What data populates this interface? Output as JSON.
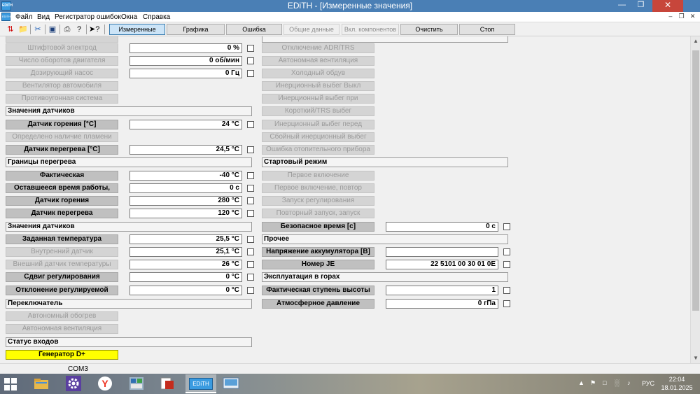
{
  "window": {
    "title": "EDiTH - [Измеренные значения]",
    "app_icon_text": "EDiTH",
    "buttons": [
      "minimize-icon",
      "restore-icon",
      "close-icon"
    ]
  },
  "menu": {
    "items": [
      "Файл",
      "Вид",
      "Регистратор ошибок",
      "Окна",
      "Справка"
    ]
  },
  "toolbar": {
    "icons": [
      "connect-icon",
      "open-folder-icon",
      "cut-icon",
      "save-icon",
      "print-icon",
      "info-icon",
      "help-icon"
    ],
    "tabs": [
      {
        "label": "Измеренные значения",
        "state": "active"
      },
      {
        "label": "Графика",
        "state": "normal"
      },
      {
        "label": "Ошибка",
        "state": "normal"
      },
      {
        "label": "Общие данные",
        "state": "disabled"
      },
      {
        "label": "Вкл. компонентов",
        "state": "disabled"
      },
      {
        "label": "Очистить",
        "state": "normal"
      },
      {
        "label": "Стоп",
        "state": "normal"
      }
    ]
  },
  "left": {
    "top_rows": [
      {
        "label": "Штифтовой электрод",
        "value": "0 %"
      },
      {
        "label": "Число оборотов двигателя",
        "value": "0 об/мин"
      },
      {
        "label": "Дозирующий насос",
        "value": "0 Гц"
      },
      {
        "label": "Вентилятор автомобиля",
        "value": null
      },
      {
        "label": "Противоугонная система",
        "value": null
      }
    ],
    "sensor_values_title": "Значения датчиков",
    "sensor_rows": [
      {
        "label": "Датчик горения [°C]",
        "value": "24 °C",
        "enabled": true
      },
      {
        "label": "Определено наличие пламени",
        "value": null,
        "enabled": false
      },
      {
        "label": "Датчик перегрева [°C]",
        "value": "24,5 °C",
        "enabled": true
      }
    ],
    "limits_title": "Границы перегрева",
    "limits_rows": [
      {
        "label": "Фактическая",
        "value": "-40 °C"
      },
      {
        "label": "Оставшееся время работы,",
        "value": "0 с"
      },
      {
        "label": "Датчик горения",
        "value": "280 °C"
      },
      {
        "label": "Датчик перегрева",
        "value": "120 °C"
      }
    ],
    "sensor_values2_title": "Значения датчиков",
    "sensor2_rows": [
      {
        "label": "Заданная температура",
        "value": "25,5 °C",
        "enabled": true
      },
      {
        "label": "Внутренний датчик",
        "value": "25,1 °C",
        "enabled": false
      },
      {
        "label": "Внешний датчик температуры",
        "value": "26 °C",
        "enabled": false
      },
      {
        "label": "Сдвиг регулирования",
        "value": "0 °C",
        "enabled": true
      },
      {
        "label": "Отклонение регулируемой",
        "value": "0 °C",
        "enabled": true
      }
    ],
    "switch_title": "Переключатель",
    "switch_rows": [
      "Автономный обогрев",
      "Автономная вентиляция"
    ],
    "inputs_title": "Статус входов",
    "inputs_rows": [
      "Генератор D+"
    ]
  },
  "right": {
    "top_rows": [
      "Отключение ADR/TRS",
      "Автономная вентиляция",
      "Холодный обдув",
      "Инерционный выбег Выкл",
      "Инерционный выбег при",
      "Короткий/TRS выбег",
      "Инерционный выбег перед",
      "Сбойный инерционный выбег",
      "Ошибка отопительного прибора"
    ],
    "start_title": "Стартовый режим",
    "start_rows": [
      "Первое включение",
      "Первое включение, повтор",
      "Запуск регулирования",
      "Повторный запуск, запуск"
    ],
    "safe_time": {
      "label": "Безопасное время [с]",
      "value": "0 с"
    },
    "other_title": "Прочее",
    "other_rows": [
      {
        "label": "Напряжение аккумулятора [B]",
        "value": ""
      },
      {
        "label": "Номер JE",
        "value": "22 5101 00 30 01 0E"
      }
    ],
    "mountain_title": "Эксплуатация в горах",
    "mountain_rows": [
      {
        "label": "Фактическая ступень высоты",
        "value": "1"
      },
      {
        "label": "Атмосферное давление",
        "value": "0 гПа"
      }
    ]
  },
  "statusbar": {
    "port": "COM3"
  },
  "taskbar": {
    "apps": [
      "explorer-icon",
      "settings-icon",
      "yandex-browser-icon",
      "network-app-icon",
      "document-app-icon",
      "edith-app-icon",
      "screen-app-icon"
    ],
    "active_app_label": "EDiTH",
    "language": "РУС",
    "time": "22:04",
    "date": "18.01.2025"
  }
}
